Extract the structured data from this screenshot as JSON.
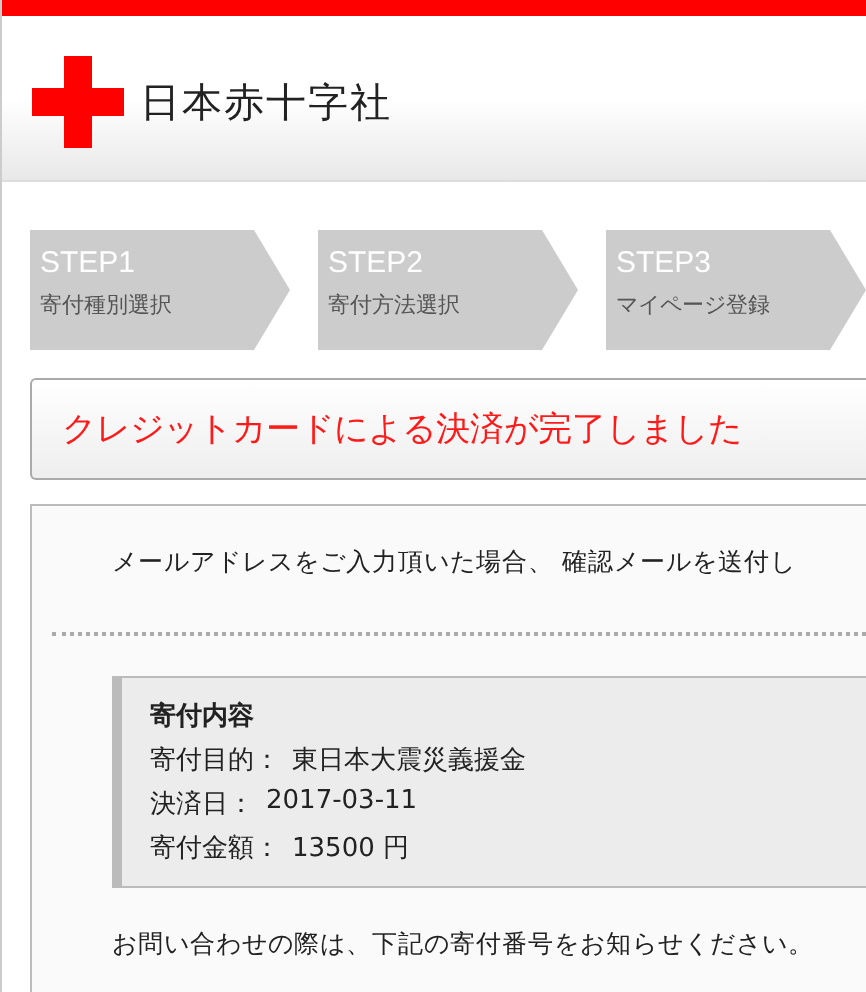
{
  "header": {
    "logo_text": "日本赤十字社"
  },
  "steps": [
    {
      "number": "STEP1",
      "label": "寄付種別選択"
    },
    {
      "number": "STEP2",
      "label": "寄付方法選択"
    },
    {
      "number": "STEP3",
      "label": "マイページ登録"
    }
  ],
  "title": "クレジットカードによる決済が完了しました",
  "notice": "メールアドレスをご入力頂いた場合、 確認メールを送付し",
  "details": {
    "heading": "寄付内容",
    "rows": [
      {
        "label": "寄付目的：",
        "value": "東日本大震災義援金"
      },
      {
        "label": "決済日：",
        "value": "2017-03-11"
      },
      {
        "label": "寄付金額：",
        "value": "13500 円"
      }
    ]
  },
  "footer_text": "お問い合わせの際は、下記の寄付番号をお知らせください。"
}
